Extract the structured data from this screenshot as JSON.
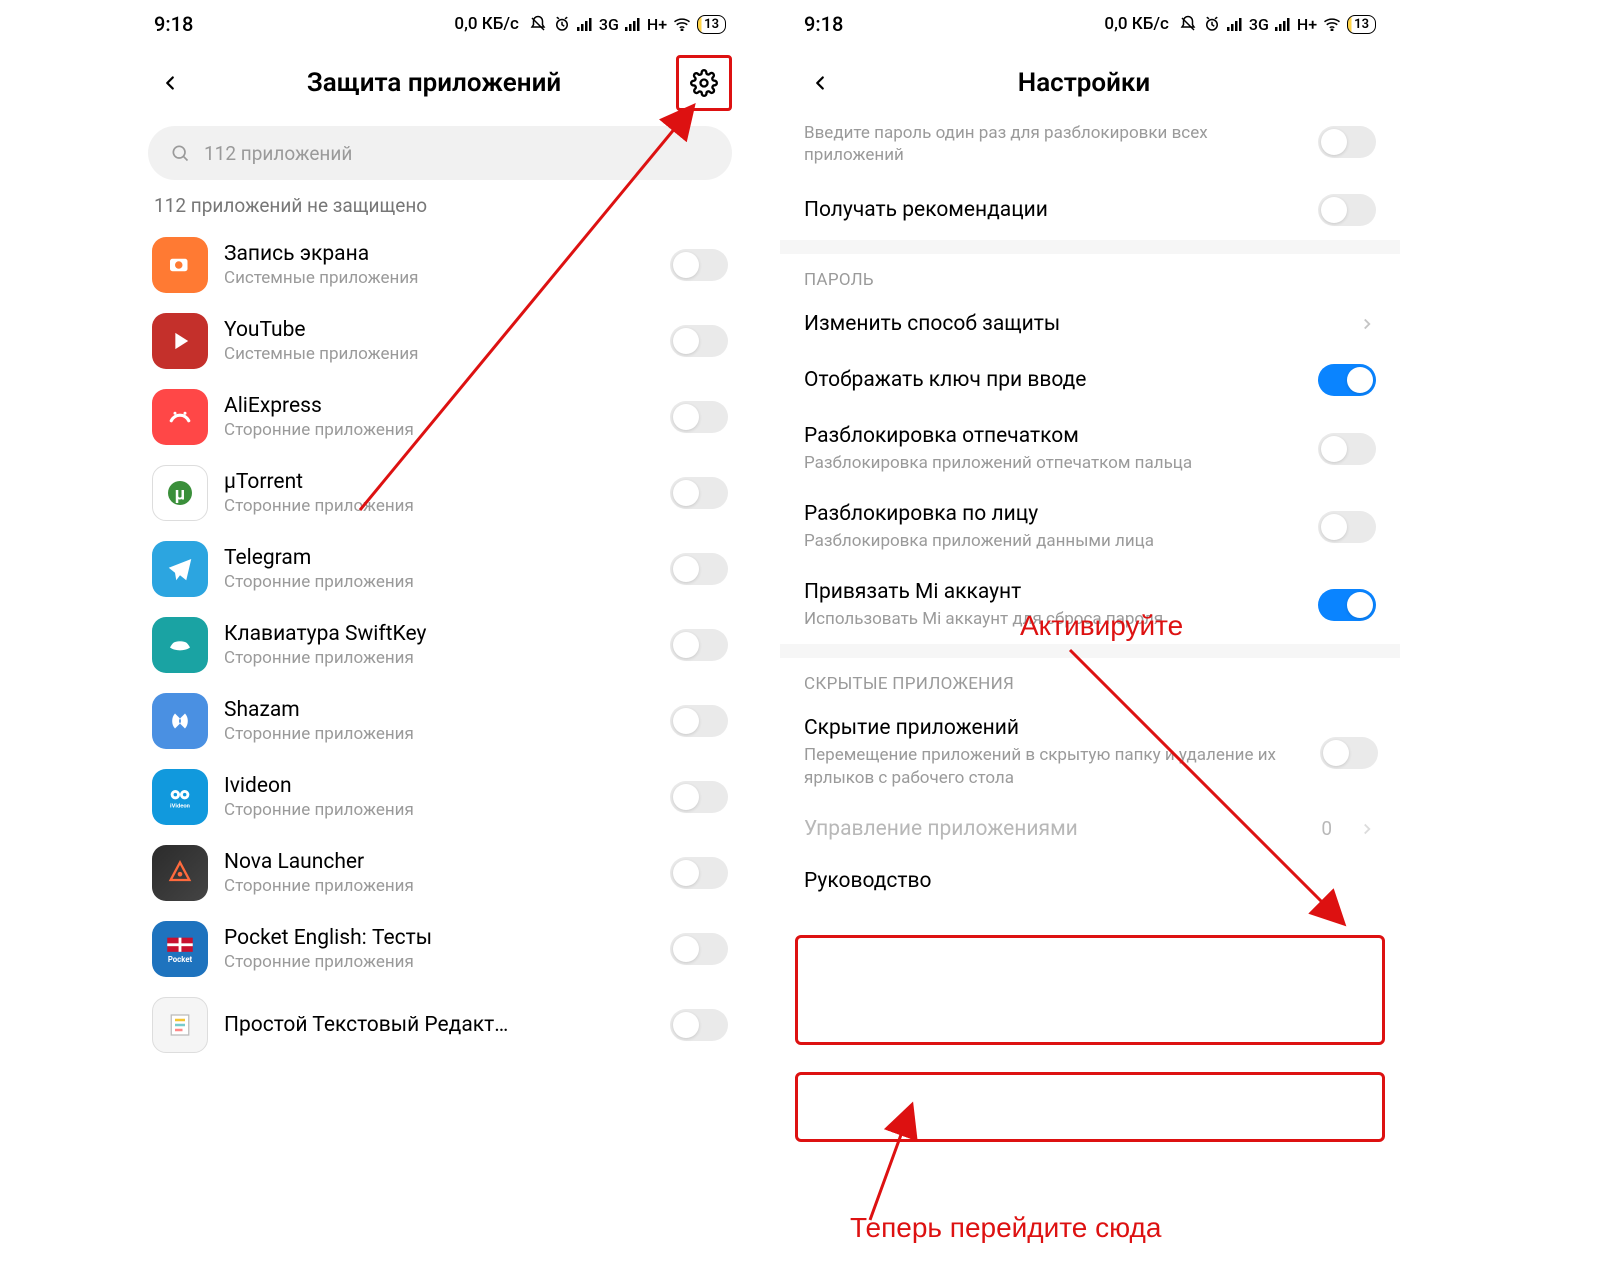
{
  "status": {
    "time": "9:18",
    "speed": "0,0 КБ/с",
    "net1": "3G",
    "net2": "H+",
    "battery": "13"
  },
  "left": {
    "title": "Защита приложений",
    "search_placeholder": "112 приложений",
    "unprotected": "112 приложений не защищено",
    "apps": [
      {
        "name": "Запись экрана",
        "sub": "Системные приложения",
        "cls": "ic-rec",
        "glyph": "rec"
      },
      {
        "name": "YouTube",
        "sub": "Системные приложения",
        "cls": "ic-yt",
        "glyph": "play"
      },
      {
        "name": "AliExpress",
        "sub": "Сторонние приложения",
        "cls": "ic-ali",
        "glyph": "ali"
      },
      {
        "name": "μTorrent",
        "sub": "Сторонние приложения",
        "cls": "ic-ut",
        "glyph": "ut"
      },
      {
        "name": "Telegram",
        "sub": "Сторонние приложения",
        "cls": "ic-tg",
        "glyph": "tg"
      },
      {
        "name": "Клавиатура SwiftKey",
        "sub": "Сторонние приложения",
        "cls": "ic-sk",
        "glyph": "sk"
      },
      {
        "name": "Shazam",
        "sub": "Сторонние приложения",
        "cls": "ic-sh",
        "glyph": "sh"
      },
      {
        "name": "Ivideon",
        "sub": "Сторонние приложения",
        "cls": "ic-iv",
        "glyph": "iv"
      },
      {
        "name": "Nova Launcher",
        "sub": "Сторонние приложения",
        "cls": "ic-nova",
        "glyph": "nova"
      },
      {
        "name": "Pocket English: Тесты",
        "sub": "Сторонние приложения",
        "cls": "ic-pe",
        "glyph": "pe"
      },
      {
        "name": "Простой Текстовый Редакт…",
        "sub": "",
        "cls": "ic-txt",
        "glyph": "txt"
      }
    ]
  },
  "right": {
    "title": "Настройки",
    "partial_sub": "Введите пароль один раз для разблокировки всех приложений",
    "recommend": "Получать рекомендации",
    "section_password": "ПАРОЛЬ",
    "change_method": "Изменить способ защиты",
    "show_key": "Отображать ключ при вводе",
    "fp_title": "Разблокировка отпечатком",
    "fp_sub": "Разблокировка приложений отпечатком пальца",
    "face_title": "Разблокировка по лицу",
    "face_sub": "Разблокировка приложений данными лица",
    "mi_title": "Привязать Mi аккаунт",
    "mi_sub": "Использовать Mi аккаунт для сброса пароля",
    "section_hidden": "СКРЫТЫЕ ПРИЛОЖЕНИЯ",
    "hide_title": "Скрытие приложений",
    "hide_sub": "Перемещение приложений в скрытую папку и удаление их ярлыков с рабочего стола",
    "manage": "Управление приложениями",
    "manage_count": "0",
    "guide": "Руководство"
  },
  "annotations": {
    "activate": "Активируйте",
    "goto": "Теперь перейдите сюда"
  }
}
